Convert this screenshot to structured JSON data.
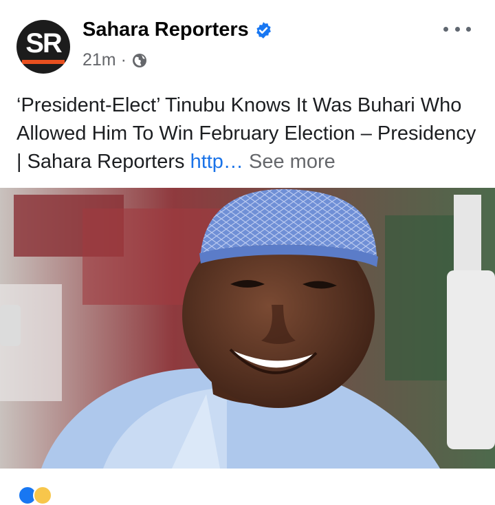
{
  "post": {
    "page_name": "Sahara Reporters",
    "avatar_text": "SR",
    "verified_icon": "verified-badge-icon",
    "timestamp": "21m",
    "separator": "·",
    "privacy_icon": "globe-icon",
    "more_icon": "more-options-icon",
    "text": "‘President-Elect’ Tinubu Knows It Was Buhari Who Allowed Him To Win February Election – Presidency | Sahara Reporters",
    "link_text": "http…",
    "see_more": "See more"
  },
  "colors": {
    "brand_orange": "#e8501f",
    "verified_blue": "#1877f2",
    "link_blue": "#1a73e8",
    "meta_gray": "#65676b",
    "cap_blue": "#6f8fd6"
  },
  "photo": {
    "subject": "smiling man in blue embroidered cap"
  },
  "reactions": [
    "like-reaction-icon",
    "haha-reaction-icon"
  ]
}
